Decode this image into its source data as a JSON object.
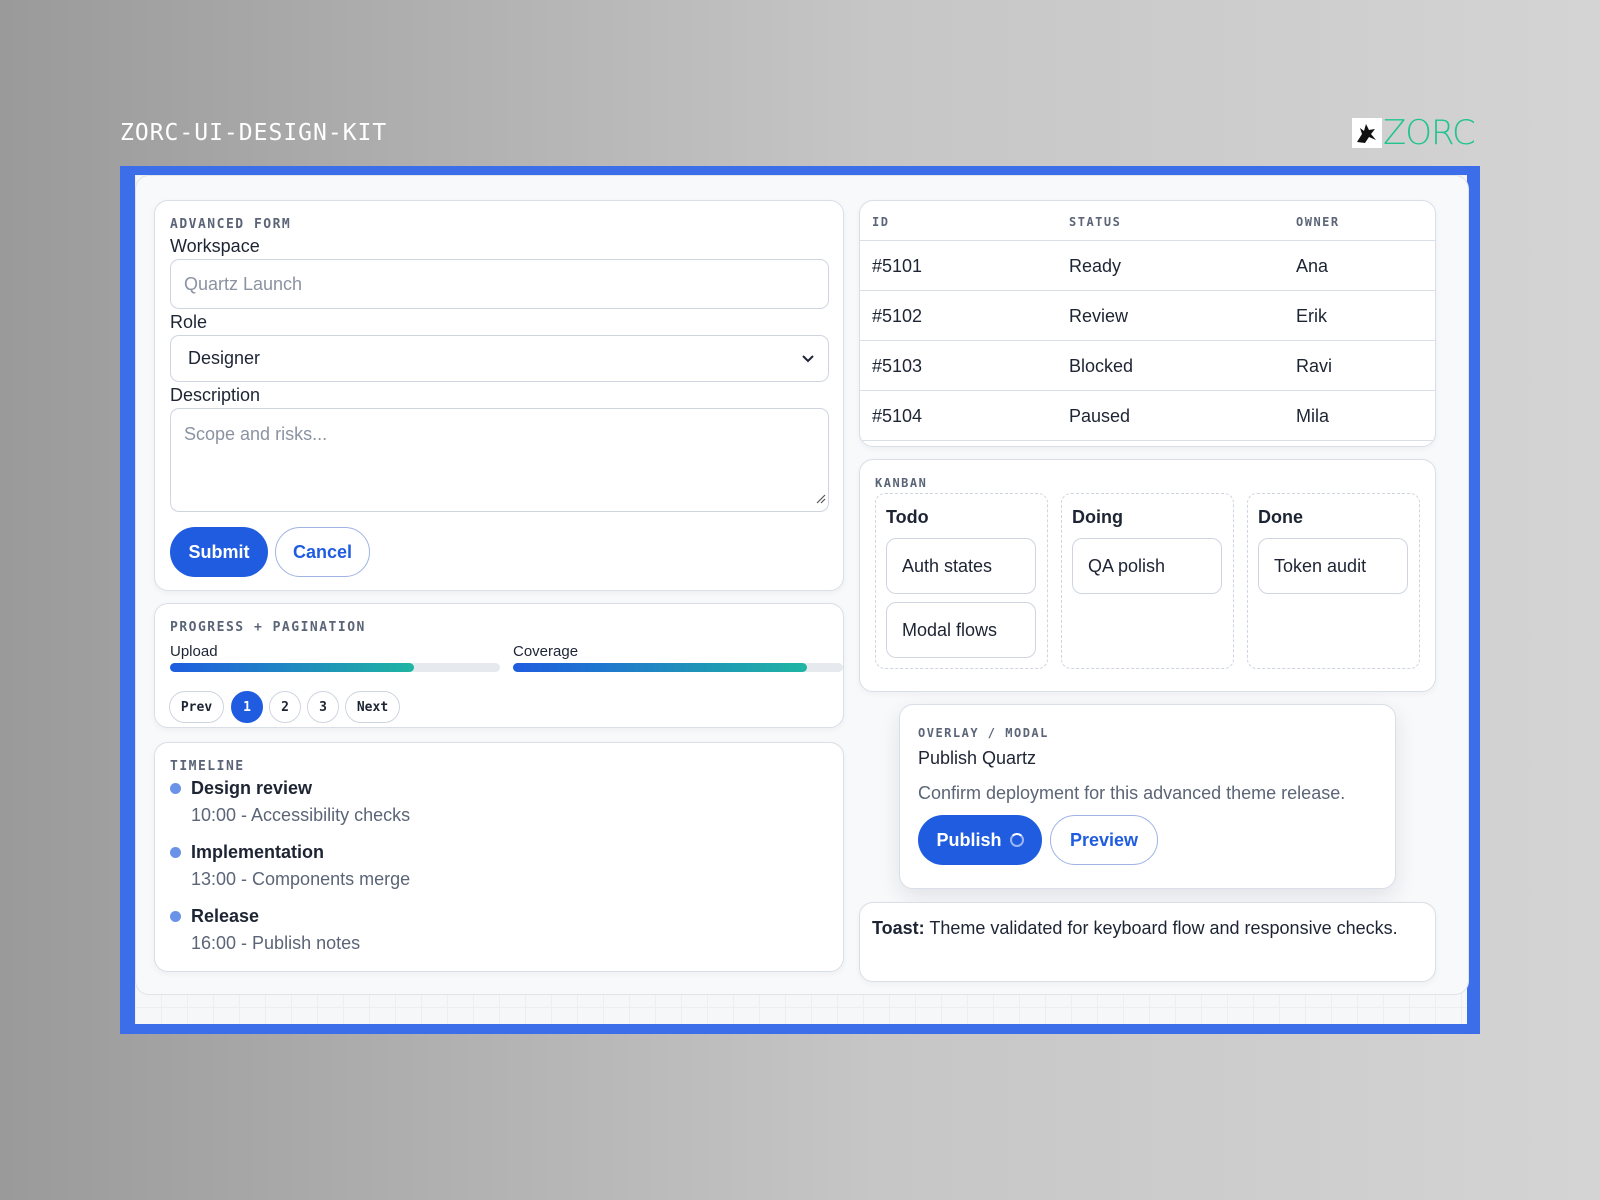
{
  "header": {
    "kit_title": "ZORC-UI-DESIGN-KIT",
    "brand_name": "ZORC",
    "brand_color": "#1fc48f",
    "frame_color": "#3b6ee8",
    "logo_icon": "zorc-wolf-icon"
  },
  "form": {
    "eyebrow": "ADVANCED FORM",
    "workspace_label": "Workspace",
    "workspace_placeholder": "Quartz Launch",
    "role_label": "Role",
    "role_value": "Designer",
    "description_label": "Description",
    "description_placeholder": "Scope and risks...",
    "submit_label": "Submit",
    "cancel_label": "Cancel"
  },
  "progress": {
    "eyebrow": "PROGRESS + PAGINATION",
    "bars": [
      {
        "label": "Upload",
        "percent": 74
      },
      {
        "label": "Coverage",
        "percent": 89
      }
    ],
    "pagination": {
      "prev": "Prev",
      "pages": [
        "1",
        "2",
        "3"
      ],
      "active": "1",
      "next": "Next"
    }
  },
  "timeline": {
    "eyebrow": "TIMELINE",
    "items": [
      {
        "title": "Design review",
        "detail": "10:00 - Accessibility checks"
      },
      {
        "title": "Implementation",
        "detail": "13:00 - Components merge"
      },
      {
        "title": "Release",
        "detail": "16:00 - Publish notes"
      }
    ]
  },
  "table": {
    "headers": [
      "ID",
      "STATUS",
      "OWNER"
    ],
    "rows": [
      [
        "#5101",
        "Ready",
        "Ana"
      ],
      [
        "#5102",
        "Review",
        "Erik"
      ],
      [
        "#5103",
        "Blocked",
        "Ravi"
      ],
      [
        "#5104",
        "Paused",
        "Mila"
      ]
    ]
  },
  "kanban": {
    "eyebrow": "KANBAN",
    "columns": [
      {
        "title": "Todo",
        "items": [
          "Auth states",
          "Modal flows"
        ]
      },
      {
        "title": "Doing",
        "items": [
          "QA polish"
        ]
      },
      {
        "title": "Done",
        "items": [
          "Token audit"
        ]
      }
    ]
  },
  "modal": {
    "eyebrow": "OVERLAY / MODAL",
    "title": "Publish Quartz",
    "body": "Confirm deployment for this advanced theme release.",
    "publish_label": "Publish",
    "preview_label": "Preview"
  },
  "toast": {
    "label": "Toast:",
    "message": "Theme validated for keyboard flow and responsive checks."
  },
  "colors": {
    "primary": "#1f5ce0",
    "accent": "#1fb5a2"
  }
}
